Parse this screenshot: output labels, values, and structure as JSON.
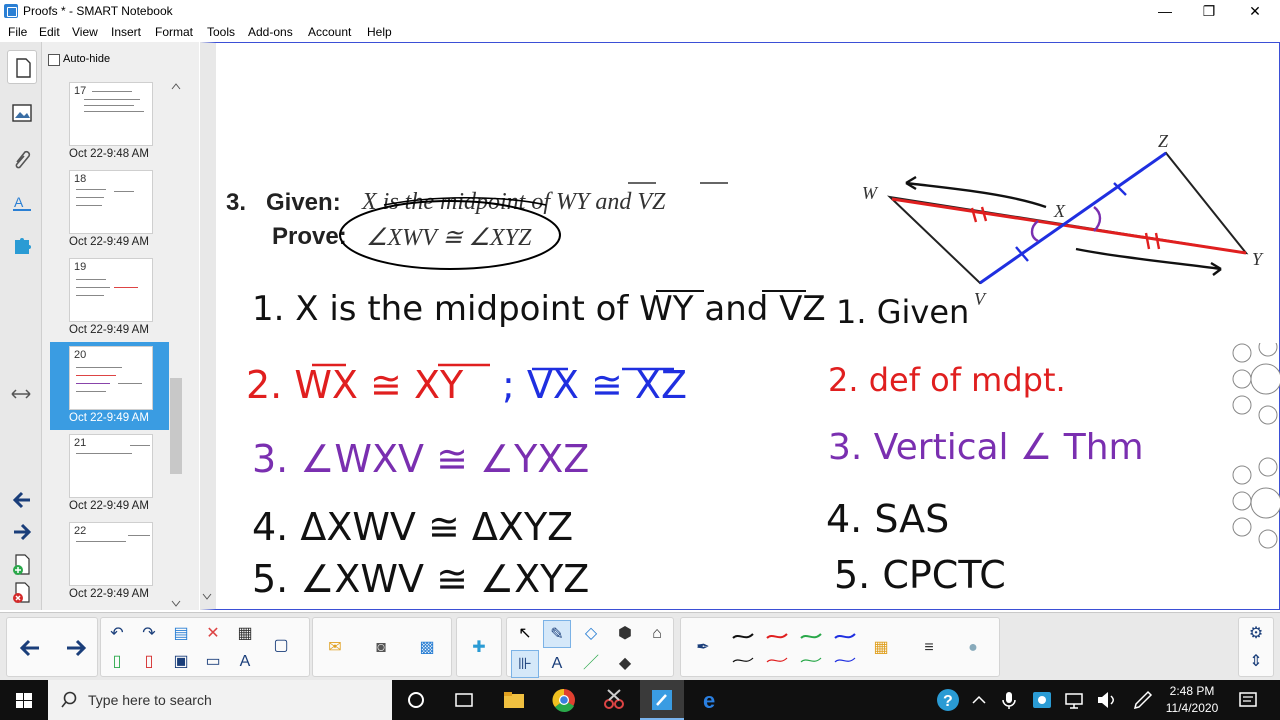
{
  "window": {
    "title": "Proofs * - SMART Notebook",
    "minimize": "—",
    "maximize": "❐",
    "close": "✕"
  },
  "menu": [
    "File",
    "Edit",
    "View",
    "Insert",
    "Format",
    "Tools",
    "Add-ons",
    "Account",
    "Help"
  ],
  "sorter": {
    "autohide_label": "Auto-hide",
    "pages": [
      {
        "num": "17",
        "date": "Oct 22-9:48 AM",
        "selected": false
      },
      {
        "num": "18",
        "date": "Oct 22-9:49 AM",
        "selected": false
      },
      {
        "num": "19",
        "date": "Oct 22-9:49 AM",
        "selected": false
      },
      {
        "num": "20",
        "date": "Oct 22-9:49 AM",
        "selected": true
      },
      {
        "num": "21",
        "date": "Oct 22-9:49 AM",
        "selected": false
      },
      {
        "num": "22",
        "date": "Oct 22-9:49 AM",
        "selected": false
      }
    ]
  },
  "canvas": {
    "problem_number": "3.",
    "given_label": "Given:",
    "given_text": "X is the midpoint of WY and VZ",
    "prove_label": "Prove:",
    "prove_text": "∠XWV ≅ ∠XYZ",
    "diagram_labels": {
      "w": "W",
      "x": "X",
      "y": "Y",
      "z": "Z",
      "v": "V"
    },
    "proof": {
      "statements": [
        "1. X is the midpoint of WY and VZ",
        "2. WX ≅ XY",
        "; VX ≅ XZ",
        "3. ∠WXV ≅ ∠YXZ",
        "4. ΔXWV ≅ ΔXYZ",
        "5. ∠XWV ≅ ∠XYZ"
      ],
      "reasons": [
        "1. Given",
        "2. def of mdpt.",
        "3. Vertical ∠ Thm",
        "4. SAS",
        "5. CPCTC"
      ]
    }
  },
  "colors": {
    "accent": "#3a9ce2",
    "canvas_border": "#3b4fd6",
    "ink_black": "#111111",
    "ink_red": "#e01f1f",
    "ink_blue": "#1f2fe0",
    "ink_purple": "#7a2fb0",
    "taskbar": "#101010"
  },
  "taskbar": {
    "search_placeholder": "Type here to search",
    "time": "2:48 PM",
    "date": "11/4/2020"
  }
}
